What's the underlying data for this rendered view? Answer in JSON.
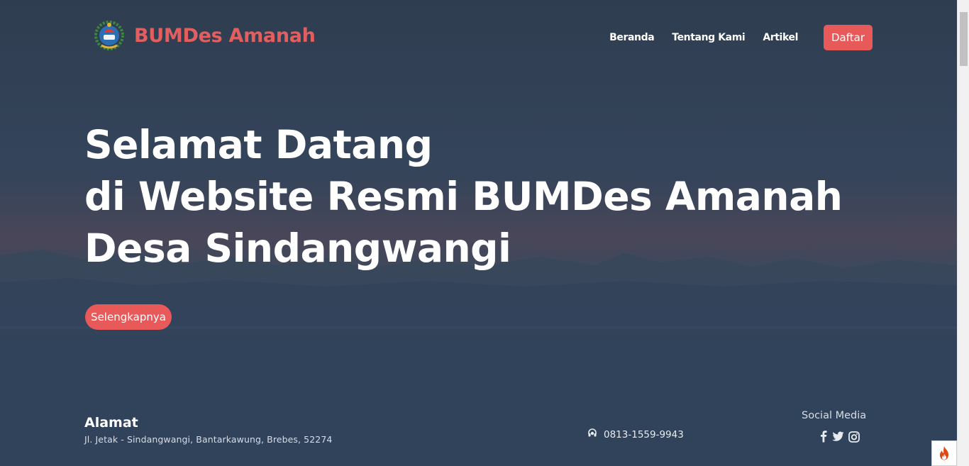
{
  "brand": {
    "name": "BUMDes Amanah",
    "logo_icon": "bumdes-emblem-icon"
  },
  "nav": {
    "items": [
      {
        "label": "Beranda"
      },
      {
        "label": "Tentang Kami"
      },
      {
        "label": "Artikel"
      }
    ],
    "cta_label": "Daftar"
  },
  "hero": {
    "line1": "Selamat Datang",
    "line2": "di Website Resmi BUMDes Amanah",
    "line3": "Desa Sindangwangi",
    "button_label": "Selengkapnya"
  },
  "footer": {
    "address_title": "Alamat",
    "address_text": "Jl. Jetak - Sindangwangi, Bantarkawung, Brebes, 52274",
    "phone": "0813-1559-9943",
    "social_title": "Social Media",
    "social_icons": [
      "facebook-icon",
      "twitter-icon",
      "instagram-icon"
    ]
  },
  "colors": {
    "accent": "#e85a5a",
    "brand_text": "#e35f5f",
    "background": "#2f3e51"
  }
}
